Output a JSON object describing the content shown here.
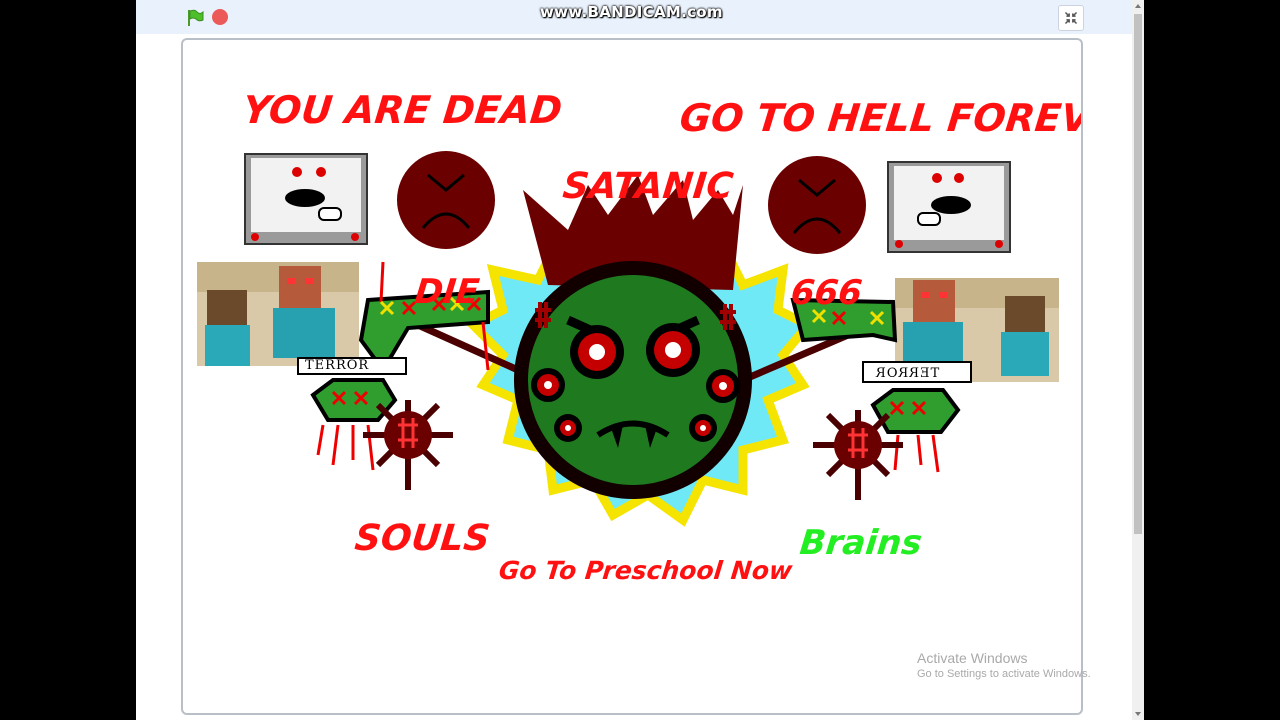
{
  "browser": {
    "watermark": "www.BANDICAM.com",
    "controls": [
      "green-flag-icon",
      "stop-icon",
      "fullscreen-icon"
    ]
  },
  "stage": {
    "texts": {
      "you_are_dead": "YOU ARE DEAD",
      "go_to_hell": "GO TO HELL FOREVER",
      "satanic": "SATANIC",
      "die": "DIE",
      "six": "666",
      "souls": "SOULS",
      "brains": "Brains",
      "preschool": "Go To Preschool Now",
      "terror_left": "TERROR",
      "terror_right": "TERROR"
    },
    "colors": {
      "red_text": "#ff1111",
      "green_text": "#22ee22",
      "face_green": "#1f7a1f",
      "dark_red": "#6b0000",
      "glow_yellow": "#f7e600",
      "glow_cyan": "#66e8f5"
    }
  },
  "os_overlay": {
    "title": "Activate Windows",
    "subtitle": "Go to Settings to activate Windows."
  }
}
